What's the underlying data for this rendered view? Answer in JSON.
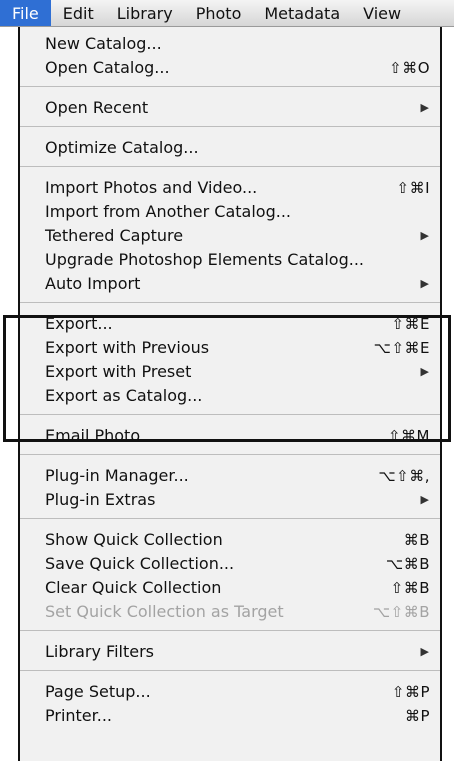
{
  "menubar": {
    "items": [
      "File",
      "Edit",
      "Library",
      "Photo",
      "Metadata",
      "View"
    ],
    "active_index": 0
  },
  "file_menu": {
    "sections": [
      [
        {
          "label": "New Catalog...",
          "shortcut": "",
          "submenu": false,
          "disabled": false
        },
        {
          "label": "Open Catalog...",
          "shortcut": "⇧⌘O",
          "submenu": false,
          "disabled": false
        }
      ],
      [
        {
          "label": "Open Recent",
          "shortcut": "",
          "submenu": true,
          "disabled": false
        }
      ],
      [
        {
          "label": "Optimize Catalog...",
          "shortcut": "",
          "submenu": false,
          "disabled": false
        }
      ],
      [
        {
          "label": "Import Photos and Video...",
          "shortcut": "⇧⌘I",
          "submenu": false,
          "disabled": false
        },
        {
          "label": "Import from Another Catalog...",
          "shortcut": "",
          "submenu": false,
          "disabled": false
        },
        {
          "label": "Tethered Capture",
          "shortcut": "",
          "submenu": true,
          "disabled": false
        },
        {
          "label": "Upgrade Photoshop Elements Catalog...",
          "shortcut": "",
          "submenu": false,
          "disabled": false
        },
        {
          "label": "Auto Import",
          "shortcut": "",
          "submenu": true,
          "disabled": false
        }
      ],
      [
        {
          "label": "Export...",
          "shortcut": "⇧⌘E",
          "submenu": false,
          "disabled": false
        },
        {
          "label": "Export with Previous",
          "shortcut": "⌥⇧⌘E",
          "submenu": false,
          "disabled": false
        },
        {
          "label": "Export with Preset",
          "shortcut": "",
          "submenu": true,
          "disabled": false
        },
        {
          "label": "Export as Catalog...",
          "shortcut": "",
          "submenu": false,
          "disabled": false
        }
      ],
      [
        {
          "label": "Email Photo...",
          "shortcut": "⇧⌘M",
          "submenu": false,
          "disabled": false
        }
      ],
      [
        {
          "label": "Plug-in Manager...",
          "shortcut": "⌥⇧⌘,",
          "submenu": false,
          "disabled": false
        },
        {
          "label": "Plug-in Extras",
          "shortcut": "",
          "submenu": true,
          "disabled": false
        }
      ],
      [
        {
          "label": "Show Quick Collection",
          "shortcut": "⌘B",
          "submenu": false,
          "disabled": false
        },
        {
          "label": "Save Quick Collection...",
          "shortcut": "⌥⌘B",
          "submenu": false,
          "disabled": false
        },
        {
          "label": "Clear Quick Collection",
          "shortcut": "⇧⌘B",
          "submenu": false,
          "disabled": false
        },
        {
          "label": "Set Quick Collection as Target",
          "shortcut": "⌥⇧⌘B",
          "submenu": false,
          "disabled": true
        }
      ],
      [
        {
          "label": "Library Filters",
          "shortcut": "",
          "submenu": true,
          "disabled": false
        }
      ],
      [
        {
          "label": "Page Setup...",
          "shortcut": "⇧⌘P",
          "submenu": false,
          "disabled": false
        },
        {
          "label": "Printer...",
          "shortcut": "⌘P",
          "submenu": false,
          "disabled": false
        }
      ]
    ],
    "submenu_arrow_glyph": "▶"
  },
  "colors": {
    "menubar_active": "#2f6fd4",
    "disabled_text": "#a3a3a3",
    "highlight_border": "#111111"
  }
}
